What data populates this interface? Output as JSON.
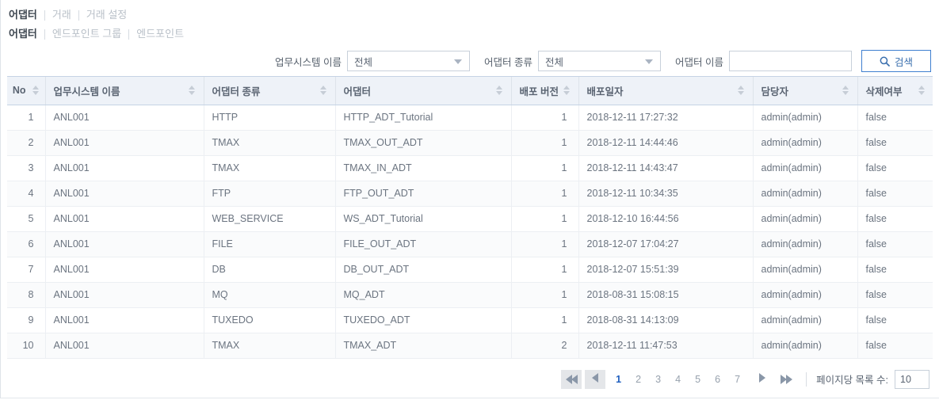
{
  "breadcrumbs": {
    "row1": [
      {
        "label": "어댑터",
        "active": true
      },
      {
        "label": "거래",
        "active": false
      },
      {
        "label": "거래 설정",
        "active": false
      }
    ],
    "row2": [
      {
        "label": "어댑터",
        "active": true
      },
      {
        "label": "엔드포인트 그룹",
        "active": false
      },
      {
        "label": "엔드포인트",
        "active": false
      }
    ]
  },
  "filter": {
    "system_label": "업무시스템 이름",
    "system_value": "전체",
    "type_label": "어댑터 종류",
    "type_value": "전체",
    "name_label": "어댑터 이름",
    "name_value": "",
    "name_placeholder": "",
    "search_label": "검색"
  },
  "table": {
    "columns": [
      {
        "key": "no",
        "label": "No",
        "align": "center",
        "sortable": true
      },
      {
        "key": "system",
        "label": "업무시스템 이름",
        "align": "left",
        "sortable": true
      },
      {
        "key": "type",
        "label": "어댑터 종류",
        "align": "left",
        "sortable": true
      },
      {
        "key": "adapter",
        "label": "어댑터",
        "align": "left",
        "sortable": true
      },
      {
        "key": "version",
        "label": "배포 버전",
        "align": "left",
        "sortable": true
      },
      {
        "key": "deploy_date",
        "label": "배포일자",
        "align": "left",
        "sortable": true
      },
      {
        "key": "owner",
        "label": "담당자",
        "align": "left",
        "sortable": true
      },
      {
        "key": "deleted",
        "label": "삭제여부",
        "align": "left",
        "sortable": true
      }
    ],
    "rows": [
      {
        "no": "1",
        "system": "ANL001",
        "type": "HTTP",
        "adapter": "HTTP_ADT_Tutorial",
        "version": "1",
        "deploy_date": "2018-12-11 17:27:32",
        "owner": "admin(admin)",
        "deleted": "false"
      },
      {
        "no": "2",
        "system": "ANL001",
        "type": "TMAX",
        "adapter": "TMAX_OUT_ADT",
        "version": "1",
        "deploy_date": "2018-12-11 14:44:46",
        "owner": "admin(admin)",
        "deleted": "false"
      },
      {
        "no": "3",
        "system": "ANL001",
        "type": "TMAX",
        "adapter": "TMAX_IN_ADT",
        "version": "1",
        "deploy_date": "2018-12-11 14:43:47",
        "owner": "admin(admin)",
        "deleted": "false"
      },
      {
        "no": "4",
        "system": "ANL001",
        "type": "FTP",
        "adapter": "FTP_OUT_ADT",
        "version": "1",
        "deploy_date": "2018-12-11 10:34:35",
        "owner": "admin(admin)",
        "deleted": "false"
      },
      {
        "no": "5",
        "system": "ANL001",
        "type": "WEB_SERVICE",
        "adapter": "WS_ADT_Tutorial",
        "version": "1",
        "deploy_date": "2018-12-10 16:44:56",
        "owner": "admin(admin)",
        "deleted": "false"
      },
      {
        "no": "6",
        "system": "ANL001",
        "type": "FILE",
        "adapter": "FILE_OUT_ADT",
        "version": "1",
        "deploy_date": "2018-12-07 17:04:27",
        "owner": "admin(admin)",
        "deleted": "false"
      },
      {
        "no": "7",
        "system": "ANL001",
        "type": "DB",
        "adapter": "DB_OUT_ADT",
        "version": "1",
        "deploy_date": "2018-12-07 15:51:39",
        "owner": "admin(admin)",
        "deleted": "false"
      },
      {
        "no": "8",
        "system": "ANL001",
        "type": "MQ",
        "adapter": "MQ_ADT",
        "version": "1",
        "deploy_date": "2018-08-31 15:08:15",
        "owner": "admin(admin)",
        "deleted": "false"
      },
      {
        "no": "9",
        "system": "ANL001",
        "type": "TUXEDO",
        "adapter": "TUXEDO_ADT",
        "version": "1",
        "deploy_date": "2018-08-31 14:13:09",
        "owner": "admin(admin)",
        "deleted": "false"
      },
      {
        "no": "10",
        "system": "ANL001",
        "type": "TMAX",
        "adapter": "TMAX_ADT",
        "version": "2",
        "deploy_date": "2018-12-11 11:47:53",
        "owner": "admin(admin)",
        "deleted": "false"
      }
    ]
  },
  "pagination": {
    "pages": [
      "1",
      "2",
      "3",
      "4",
      "5",
      "6",
      "7"
    ],
    "current_page": "1",
    "page_size_label": "페이지당 목록 수:",
    "page_size_value": "10"
  },
  "colors": {
    "accent": "#1f5fbf",
    "header_bg": "#eef2f8",
    "button_border": "#3f7fd0"
  }
}
